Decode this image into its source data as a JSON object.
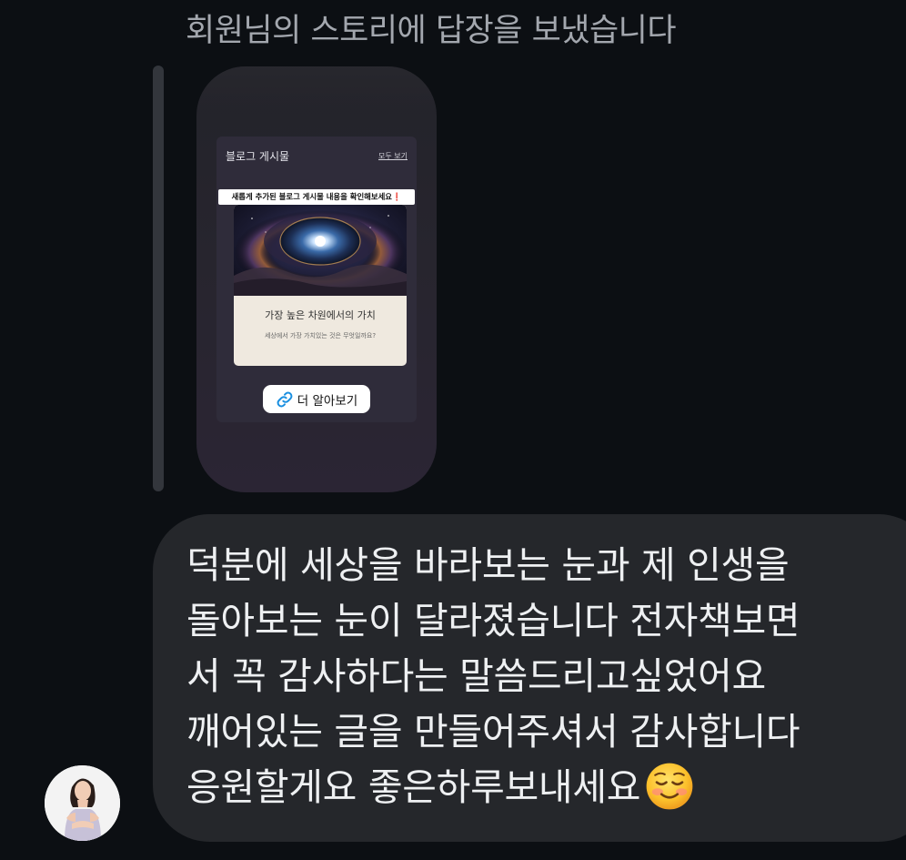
{
  "header": {
    "reply_notice": "회원님의 스토리에 답장을 보냈습니다"
  },
  "story": {
    "panel_title": "블로그 게시물",
    "view_all_label": "모두 보기",
    "sticker_text": "새롭게 추가된 블로그 게시물 내용을 확인해보세요❗",
    "post": {
      "image_icon": "cosmic-eye-image",
      "title": "가장 높은 차원에서의 가치",
      "subtitle": "세상에서 가장 가치있는 것은 무엇일까요?"
    },
    "link_button": {
      "icon": "link-icon",
      "label": "더 알아보기",
      "icon_color": "#1a8fe0"
    }
  },
  "message": {
    "lines": [
      "덕분에 세상을 바라보는 눈과 제 인생을",
      "돌아보는 눈이 달라졌습니다 전자책보면",
      "서 꼭 감사하다는 말씀드리고싶었어요",
      "깨어있는 글을 만들어주셔서 감사합니다",
      "응원할게요 좋은하루보내세요"
    ],
    "emoji": "smiling-face-emoji"
  },
  "sender": {
    "avatar_icon": "profile-avatar"
  },
  "colors": {
    "background": "#0c0f13",
    "bubble": "#25272b",
    "header_text": "#a3a7ae",
    "message_text": "#eef0f2"
  }
}
